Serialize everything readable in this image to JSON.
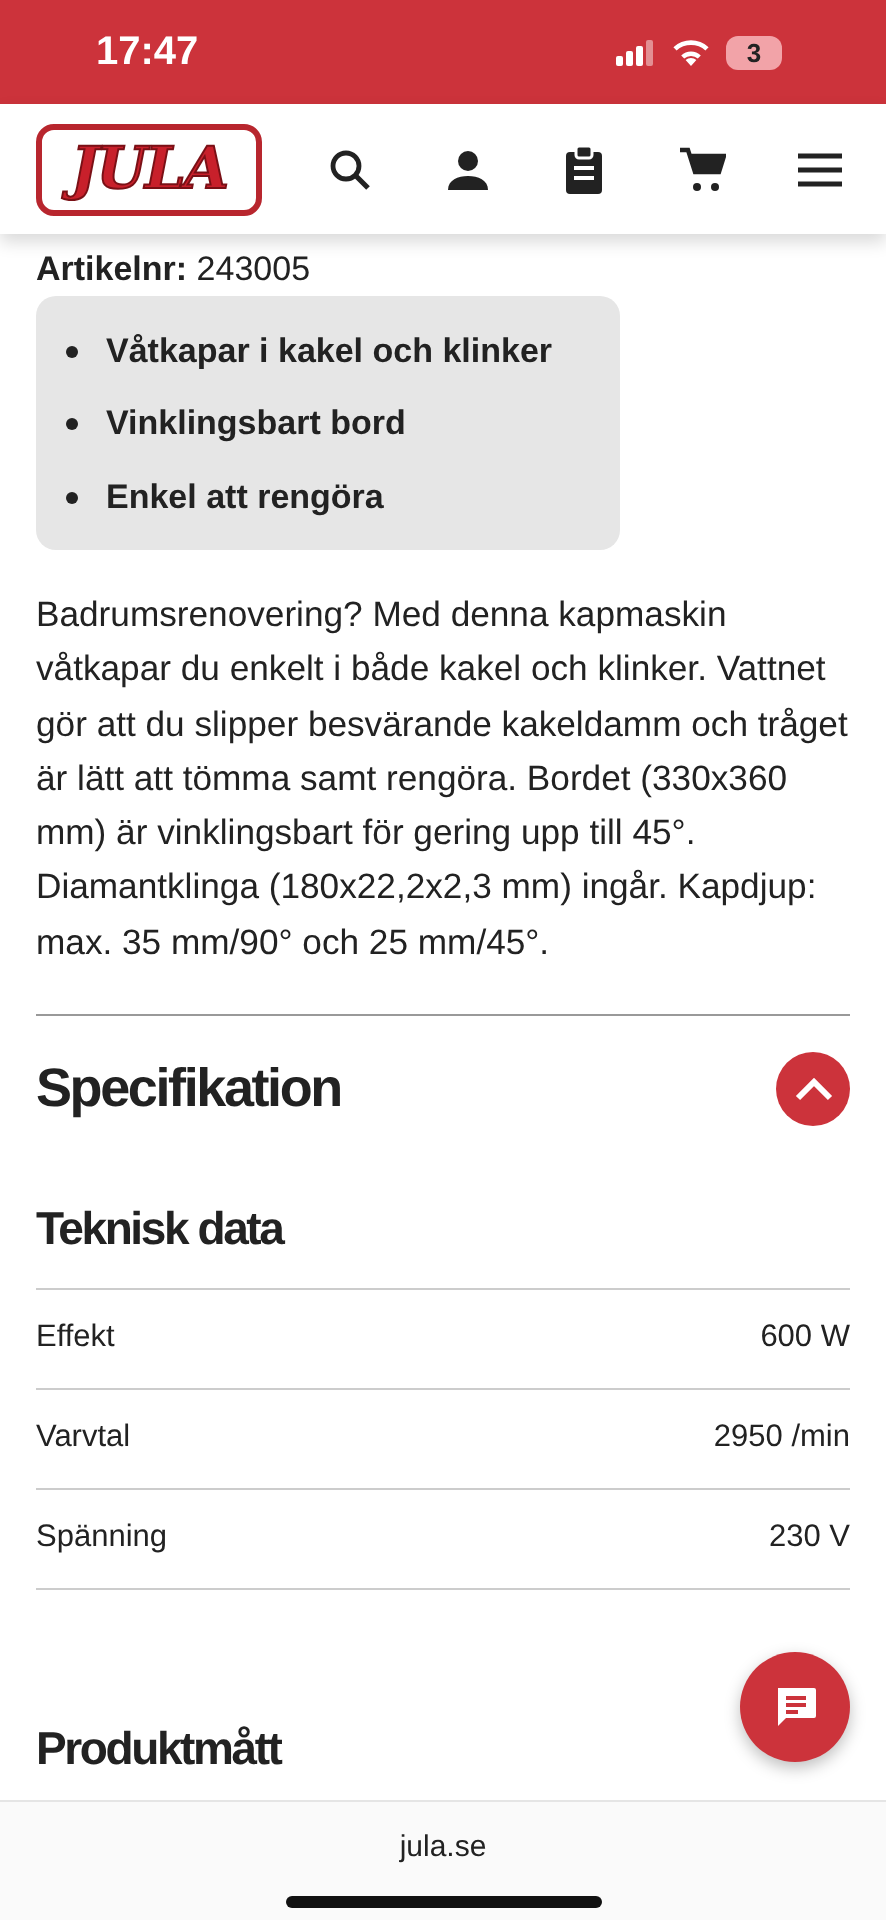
{
  "status_bar": {
    "time": "17:47",
    "battery": "3"
  },
  "header": {
    "logo": "JULA"
  },
  "article": "**Artikelnr:** 243005",
  "features": [
    "Våtkapar i kakel och klinker",
    "Vinklingsbart bord",
    "Enkel att rengöra"
  ],
  "description": "Badrumsrenovering? Med denna kapmaskin våtkapar du enkelt i både kakel och klinker. Vattnet gör att du slipper besvärande kakeldamm och tråget är lätt att tömma samt rengöra. Bordet (330x360 mm) är vinklingsbart för gering upp till 45°. Diamantklinga (180x22,2x2,3 mm) ingår. Kapdjup: max. 35 mm/90° och 25 mm/45°.",
  "specification": {
    "title": "Specifikation",
    "expanded": true,
    "sections": [
      {
        "title": "Teknisk data",
        "rows": [
          {
            "label": "Effekt",
            "value": "600 W"
          },
          {
            "label": "Varvtal",
            "value": "2950 /min"
          },
          {
            "label": "Spänning",
            "value": "230 V"
          }
        ]
      },
      {
        "title": "Produktmått"
      }
    ]
  },
  "browser_bar": {
    "url": "jula.se"
  }
}
